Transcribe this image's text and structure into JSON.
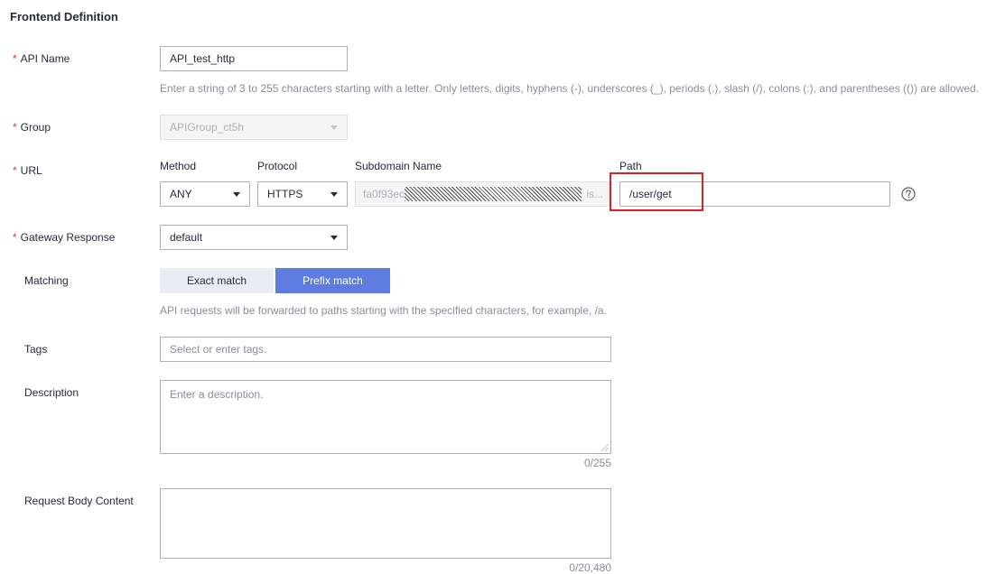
{
  "section_title": "Frontend Definition",
  "api_name": {
    "label": "API Name",
    "value": "API_test_http",
    "hint": "Enter a string of 3 to 255 characters starting with a letter. Only letters, digits, hyphens (-), underscores (_), periods (.), slash (/), colons (:), and parentheses (()) are allowed."
  },
  "group": {
    "label": "Group",
    "value": "APIGroup_ct5h"
  },
  "url": {
    "label": "URL",
    "method_label": "Method",
    "method_value": "ANY",
    "protocol_label": "Protocol",
    "protocol_value": "HTTPS",
    "subdomain_label": "Subdomain Name",
    "subdomain_prefix": "fa0f93ec",
    "subdomain_suffix": "is...",
    "path_label": "Path",
    "path_value": "/user/get",
    "help_icon": "question-circle-icon"
  },
  "gateway_response": {
    "label": "Gateway Response",
    "value": "default"
  },
  "matching": {
    "label": "Matching",
    "options": [
      "Exact match",
      "Prefix match"
    ],
    "selected": "Prefix match",
    "hint": "API requests will be forwarded to paths starting with the specified characters, for example, /a."
  },
  "tags": {
    "label": "Tags",
    "placeholder": "Select or enter tags."
  },
  "description": {
    "label": "Description",
    "placeholder": "Enter a description.",
    "counter": "0/255"
  },
  "request_body": {
    "label": "Request Body Content",
    "counter": "0/20,480"
  },
  "colors": {
    "required": "#e62e2e",
    "primary": "#5e7ce0",
    "highlight_box": "#e02020"
  }
}
